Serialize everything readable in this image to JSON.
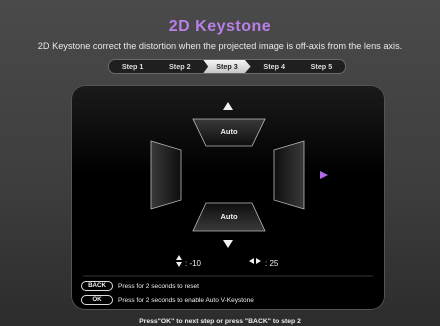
{
  "header": {
    "title": "2D Keystone",
    "subtitle": "2D Keystone correct the distortion when the projected image is off-axis from the lens axis."
  },
  "steps": [
    {
      "label": "Step 1",
      "active": false
    },
    {
      "label": "Step 2",
      "active": false
    },
    {
      "label": "Step 3",
      "active": true
    },
    {
      "label": "Step 4",
      "active": false
    },
    {
      "label": "Step 5",
      "active": false
    }
  ],
  "keystone": {
    "top_auto_label": "Auto",
    "bottom_auto_label": "Auto",
    "vertical_value": ": -10",
    "horizontal_value": ": 25",
    "accent_color": "#b36be8"
  },
  "hints": [
    {
      "key": "BACK",
      "text": "Press for 2 seconds to reset"
    },
    {
      "key": "OK",
      "text": "Press for 2 seconds to enable Auto V-Keystone"
    }
  ],
  "footer": "Press\"OK\" to next step or press \"BACK\" to step 2"
}
